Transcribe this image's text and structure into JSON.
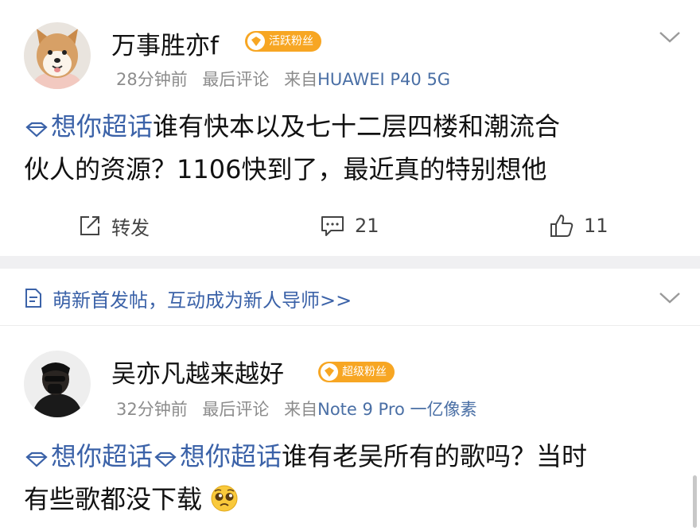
{
  "post1": {
    "username": "万事胜亦f",
    "badge": "活跃粉丝",
    "time": "28分钟前",
    "last_comment": "最后评论",
    "source_prefix": "来自",
    "source": "HUAWEI P40 5G",
    "topic": "想你超话",
    "content_line1": "谁有快本以及七十二层四楼和潮流合",
    "content_line2": "伙人的资源？1106快到了，最近真的特别想他",
    "repost_label": "转发",
    "comment_count": "21",
    "like_count": "11"
  },
  "notice": {
    "text": "萌新首发帖，互动成为新人导师>>"
  },
  "post2": {
    "username": "吴亦凡越来越好",
    "badge": "超级粉丝",
    "time": "32分钟前",
    "last_comment": "最后评论",
    "source_prefix": "来自",
    "source": "Note 9 Pro 一亿像素",
    "topic1": "想你超话",
    "topic2": "想你超话",
    "content_line1": "谁有老吴所有的歌吗？当时",
    "content_line2": "有些歌都没下载"
  },
  "colors": {
    "topic_blue": "#3b62a8",
    "meta_gray": "#8c8c8c",
    "badge_orange": "#f7a623",
    "separator": "#f0f0f2"
  },
  "icons": [
    "shiba-avatar",
    "user-avatar",
    "diamond-topic-icon",
    "chevron-down-icon",
    "repost-icon",
    "comment-icon",
    "like-icon",
    "document-icon",
    "pleading-emoji",
    "fan-badge-icon"
  ]
}
